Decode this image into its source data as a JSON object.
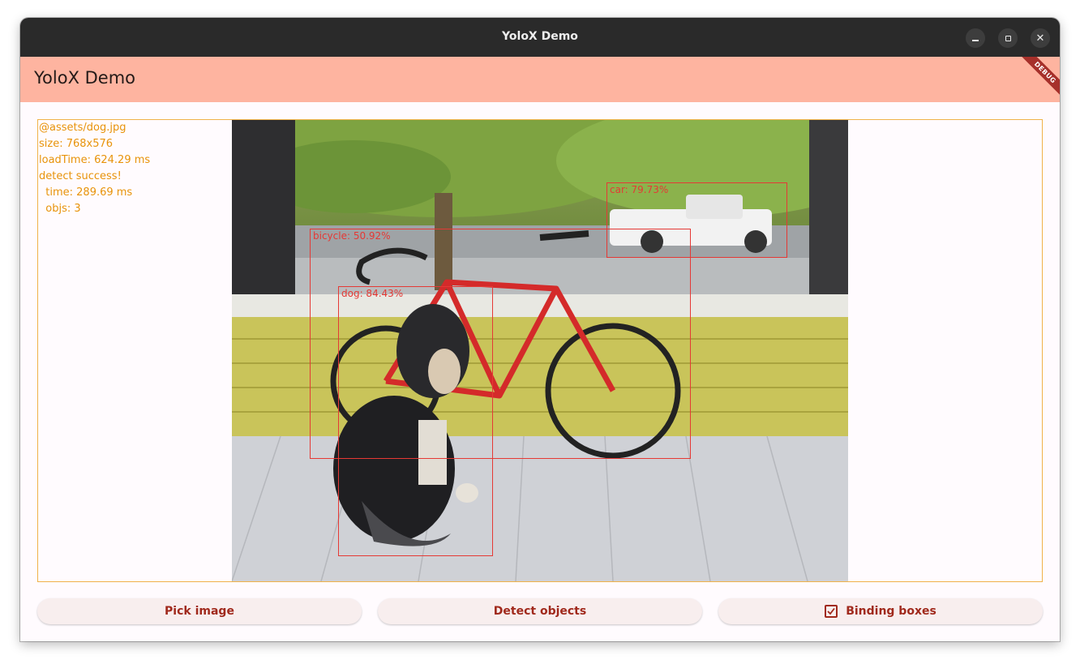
{
  "window": {
    "title": "YoloX Demo"
  },
  "appbar": {
    "title": "YoloX Demo",
    "debug_banner": "DEBUG",
    "color": "#feb4a0"
  },
  "info": {
    "path": "@assets/dog.jpg",
    "size": "size: 768x576",
    "load_time": "loadTime: 624.29 ms",
    "status": "detect success!",
    "time": "  time: 289.69 ms",
    "objs": "  objs: 3",
    "color": "#e8930a"
  },
  "detections": [
    {
      "label": "car: 79.73%"
    },
    {
      "label": "bicycle: 50.92%"
    },
    {
      "label": "dog: 84.43%"
    }
  ],
  "buttons": {
    "pick_image": "Pick image",
    "detect_objects": "Detect objects",
    "binding_boxes": "Binding boxes",
    "binding_boxes_checked": true
  },
  "colors": {
    "accent": "#a0291c",
    "box": "#e53935",
    "border": "#f0b24a"
  }
}
